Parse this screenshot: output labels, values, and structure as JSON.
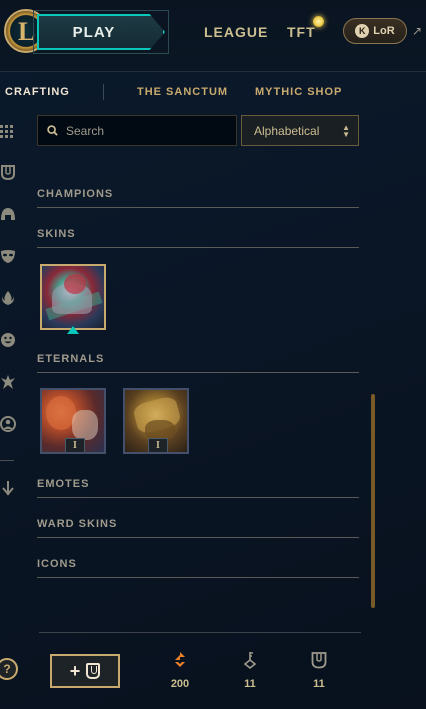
{
  "topbar": {
    "play_label": "PLAY",
    "nav": [
      "LEAGUE",
      "TFT"
    ],
    "lor_label": "LoR"
  },
  "subnav": {
    "items": [
      "CRAFTING",
      "THE SANCTUM",
      "MYTHIC SHOP"
    ],
    "active": "CRAFTING"
  },
  "toolbar": {
    "search_placeholder": "Search",
    "sort_value": "Alphabetical"
  },
  "categories": [
    "CHAMPIONS",
    "SKINS",
    "ETERNALS",
    "EMOTES",
    "WARD SKINS",
    "ICONS"
  ],
  "eternal_tiles": [
    {
      "badge": "I"
    },
    {
      "badge": "I"
    }
  ],
  "footer": {
    "add_label": "+",
    "currencies": [
      {
        "icon": "orange-essence-icon",
        "value": "200"
      },
      {
        "icon": "key-fragment-icon",
        "value": "11"
      },
      {
        "icon": "chest-icon",
        "value": "11"
      }
    ],
    "help_label": "?"
  },
  "colors": {
    "gold": "#c8aa6e",
    "teal": "#0ac8b9",
    "orange_essence": "#f0822a",
    "background": "#0a1626"
  }
}
